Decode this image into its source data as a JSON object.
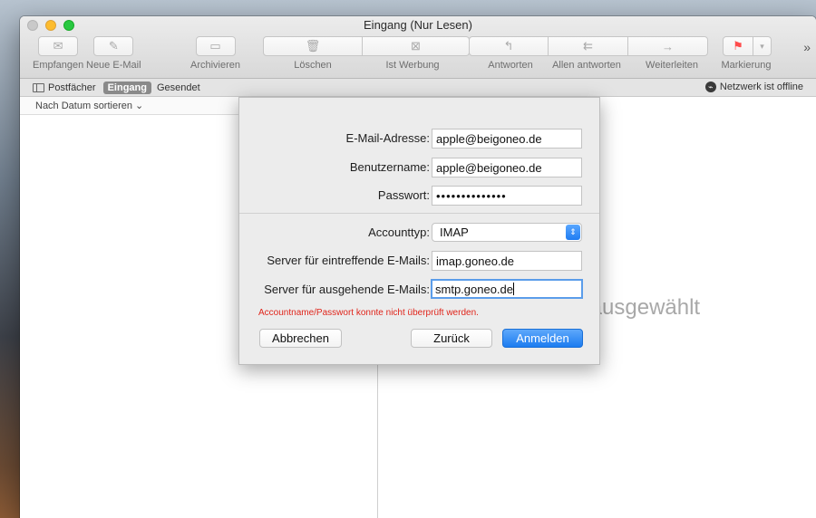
{
  "window": {
    "title": "Eingang (Nur Lesen)"
  },
  "toolbar": {
    "get_mail": "Empfangen",
    "new_mail": "Neue E-Mail",
    "archive": "Archivieren",
    "delete": "Löschen",
    "junk": "Ist Werbung",
    "reply": "Antworten",
    "reply_all": "Allen antworten",
    "forward": "Weiterleiten",
    "flag": "Markierung",
    "more": "»"
  },
  "favorites": {
    "mailboxes": "Postfächer",
    "inbox": "Eingang",
    "sent": "Gesendet",
    "network_status": "Netzwerk ist offline"
  },
  "message_list": {
    "sort_label": "Nach Datum sortieren ⌄"
  },
  "viewer": {
    "empty_text": "ht ausgewählt"
  },
  "dialog": {
    "email_label": "E-Mail-Adresse:",
    "email_value": "apple@beigoneo.de",
    "username_label": "Benutzername:",
    "username_value": "apple@beigoneo.de",
    "password_label": "Passwort:",
    "password_value": "••••••••••••••",
    "account_type_label": "Accounttyp:",
    "account_type_value": "IMAP",
    "incoming_label": "Server für eintreffende E-Mails:",
    "incoming_value": "imap.goneo.de",
    "outgoing_label": "Server für ausgehende E-Mails:",
    "outgoing_value": "smtp.goneo.de",
    "error_text": "Accountname/Passwort konnte nicht überprüft werden.",
    "cancel": "Abbrechen",
    "back": "Zurück",
    "sign_in": "Anmelden"
  }
}
